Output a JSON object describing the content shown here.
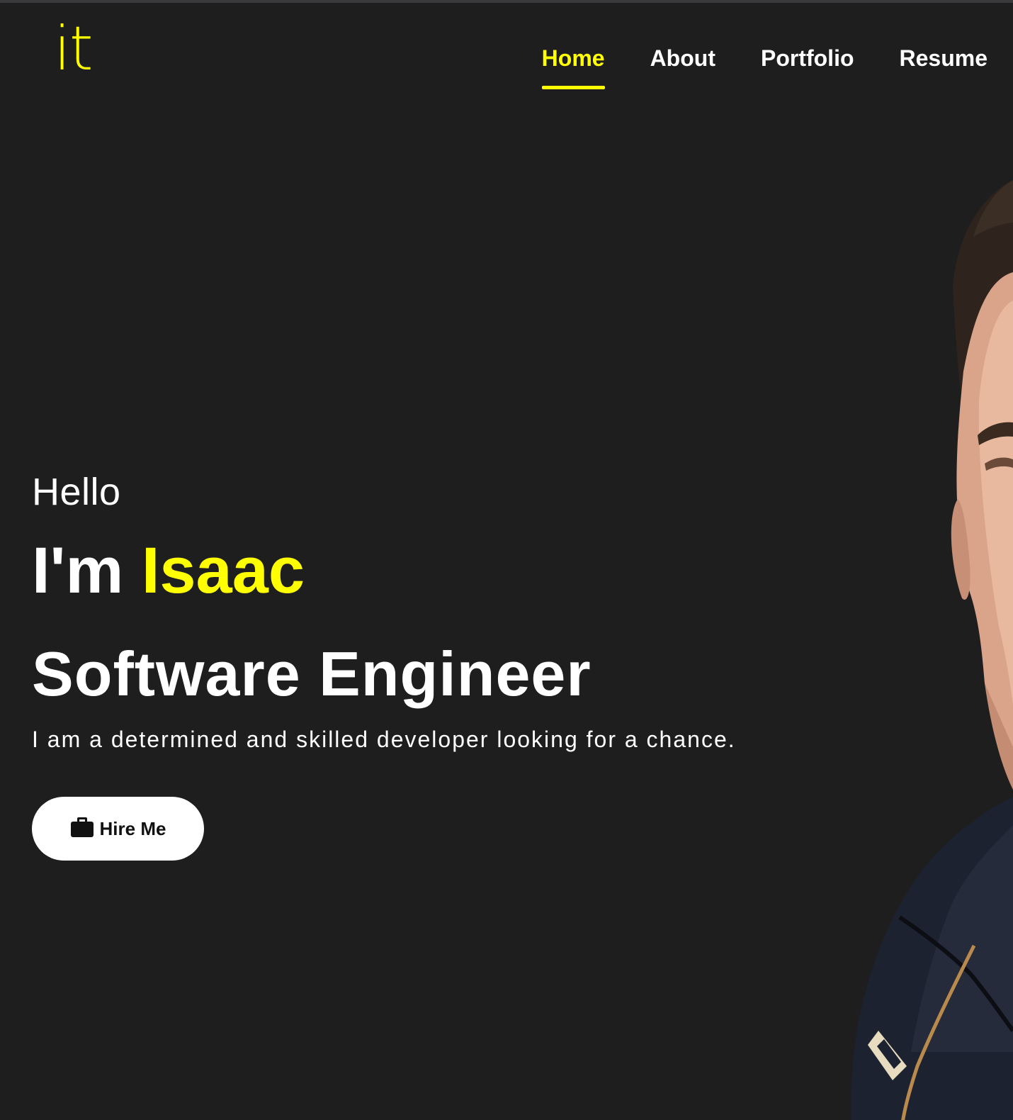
{
  "logo": {
    "text": "it"
  },
  "nav": {
    "items": [
      {
        "label": "Home",
        "active": true
      },
      {
        "label": "About",
        "active": false
      },
      {
        "label": "Portfolio",
        "active": false
      },
      {
        "label": "Resume",
        "active": false
      }
    ]
  },
  "hero": {
    "greeting": "Hello",
    "intro_prefix": "I'm ",
    "name": "Isaac",
    "role": "Software Engineer",
    "tagline": "I am a determined and skilled developer looking for a chance.",
    "cta_label": "Hire Me",
    "cta_icon": "briefcase-icon"
  },
  "colors": {
    "background": "#1e1e1f",
    "accent": "#ffff00",
    "text": "#ffffff"
  }
}
